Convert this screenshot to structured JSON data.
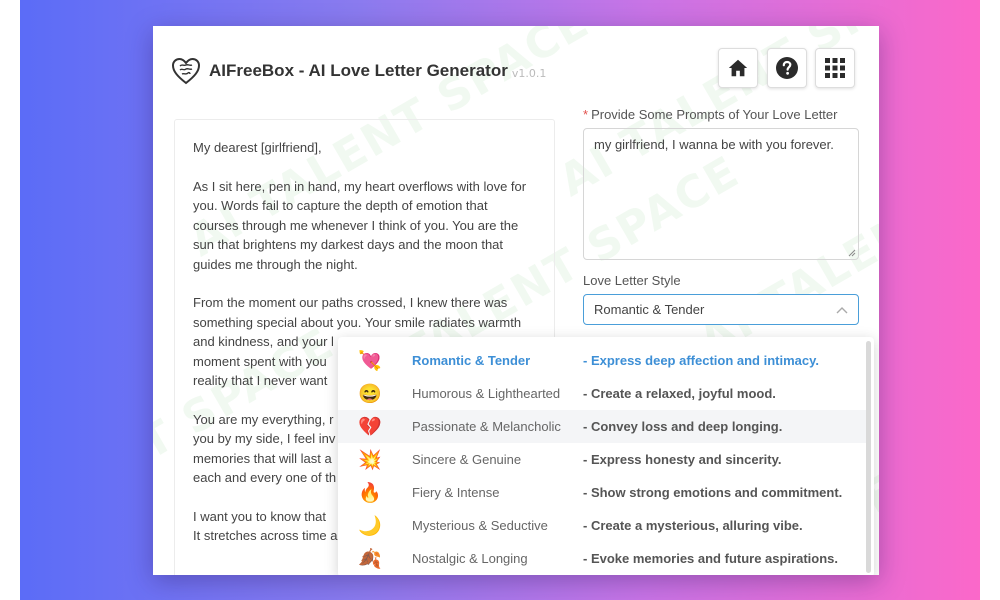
{
  "app": {
    "title": "AIFreeBox - AI Love Letter Generator",
    "version": "v1.0.1"
  },
  "toolbar": {
    "home_icon": "home-icon",
    "help_icon": "help-icon",
    "grid_icon": "grid-icon"
  },
  "watermark": {
    "text": "AI TALENT SPACE",
    "short": "ENT SPACE"
  },
  "letter": {
    "paragraphs": [
      "My dearest [girlfriend],",
      "As I sit here, pen in hand, my heart overflows with love for you. Words fail to capture the depth of emotion that courses through me whenever I think of you. You are the sun that brightens my darkest days and the moon that guides me through the night.",
      "From the moment our paths crossed, I knew there was something special about you. Your smile radiates warmth and kindness, and your l",
      "moment spent with you",
      "reality that I never want",
      "You are my everything, r",
      "you by my side, I feel inv",
      "memories that will last a",
      "each and every one of th",
      "I want you to know that",
      "It stretches across time a"
    ]
  },
  "prompt": {
    "label": "Provide Some Prompts of Your Love Letter",
    "required_mark": "*",
    "value": "my girlfriend, I wanna be with you forever."
  },
  "style": {
    "label": "Love Letter Style",
    "selected": "Romantic & Tender",
    "options": [
      {
        "emoji": "💘",
        "name": "Romantic & Tender",
        "desc": "- Express deep affection and intimacy."
      },
      {
        "emoji": "😄",
        "name": "Humorous & Lighthearted",
        "desc": "- Create a relaxed, joyful mood."
      },
      {
        "emoji": "💔",
        "name": "Passionate & Melancholic",
        "desc": "- Convey loss and deep longing."
      },
      {
        "emoji": "💥",
        "name": "Sincere & Genuine",
        "desc": "- Express honesty and sincerity."
      },
      {
        "emoji": "🔥",
        "name": "Fiery & Intense",
        "desc": "- Show strong emotions and commitment."
      },
      {
        "emoji": "🌙",
        "name": "Mysterious & Seductive",
        "desc": "- Create a mysterious, alluring vibe."
      },
      {
        "emoji": "🍂",
        "name": "Nostalgic & Longing",
        "desc": "- Evoke memories and future aspirations."
      }
    ]
  },
  "colors": {
    "accent": "#3d8fd6",
    "required": "#e2504c",
    "gradient_left": "#5b6cf7",
    "gradient_right": "#fb68c9"
  }
}
